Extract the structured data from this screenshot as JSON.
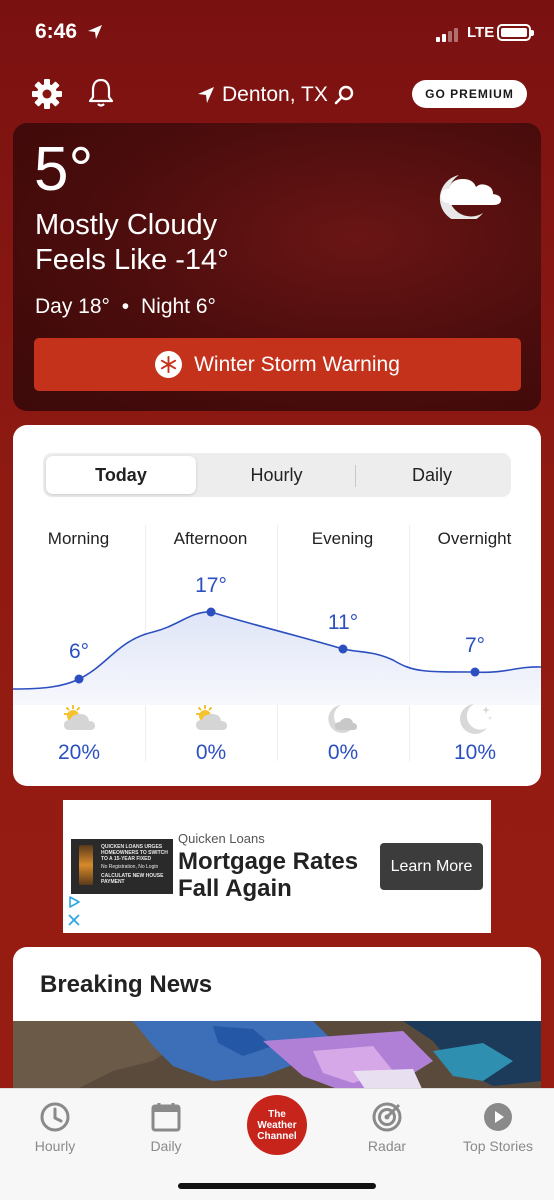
{
  "status_bar": {
    "time": "6:46",
    "network": "LTE"
  },
  "header": {
    "location": "Denton, TX",
    "premium_label": "GO PREMIUM"
  },
  "current": {
    "temperature": "5°",
    "condition": "Mostly Cloudy",
    "feels_like": "Feels Like -14°",
    "day_label": "Day 18°",
    "separator": "•",
    "night_label": "Night 6°",
    "warning": "Winter Storm Warning",
    "icon": "cloud-moon-icon"
  },
  "forecast": {
    "tabs": [
      "Today",
      "Hourly",
      "Daily"
    ],
    "active_tab": "Today",
    "periods": [
      {
        "label": "Morning",
        "temp": "6°",
        "precip": "20%",
        "icon": "partly-sunny-icon"
      },
      {
        "label": "Afternoon",
        "temp": "17°",
        "precip": "0%",
        "icon": "partly-sunny-icon"
      },
      {
        "label": "Evening",
        "temp": "11°",
        "precip": "0%",
        "icon": "cloudy-moon-icon"
      },
      {
        "label": "Overnight",
        "temp": "7°",
        "precip": "10%",
        "icon": "clear-night-icon"
      }
    ],
    "line_color": "#2c4fc0"
  },
  "ad": {
    "brand": "Quicken Loans",
    "headline": "Mortgage Rates Fall Again",
    "button": "Learn More",
    "thumb_text": "QUICKEN LOANS URGES HOMEOWNERS TO SWITCH TO A 15-YEAR FIXED",
    "thumb_subtext": "No Registration, No Login",
    "thumb_cta": "CALCULATE NEW HOUSE PAYMENT"
  },
  "news": {
    "title": "Breaking News"
  },
  "tab_bar": {
    "items": [
      "Hourly",
      "Daily",
      "Radar",
      "Top Stories"
    ],
    "logo_line1": "The",
    "logo_line2": "Weather",
    "logo_line3": "Channel"
  },
  "colors": {
    "background": "#8e1a12",
    "warning": "#c4321c",
    "accent_blue": "#2c4fc0"
  }
}
